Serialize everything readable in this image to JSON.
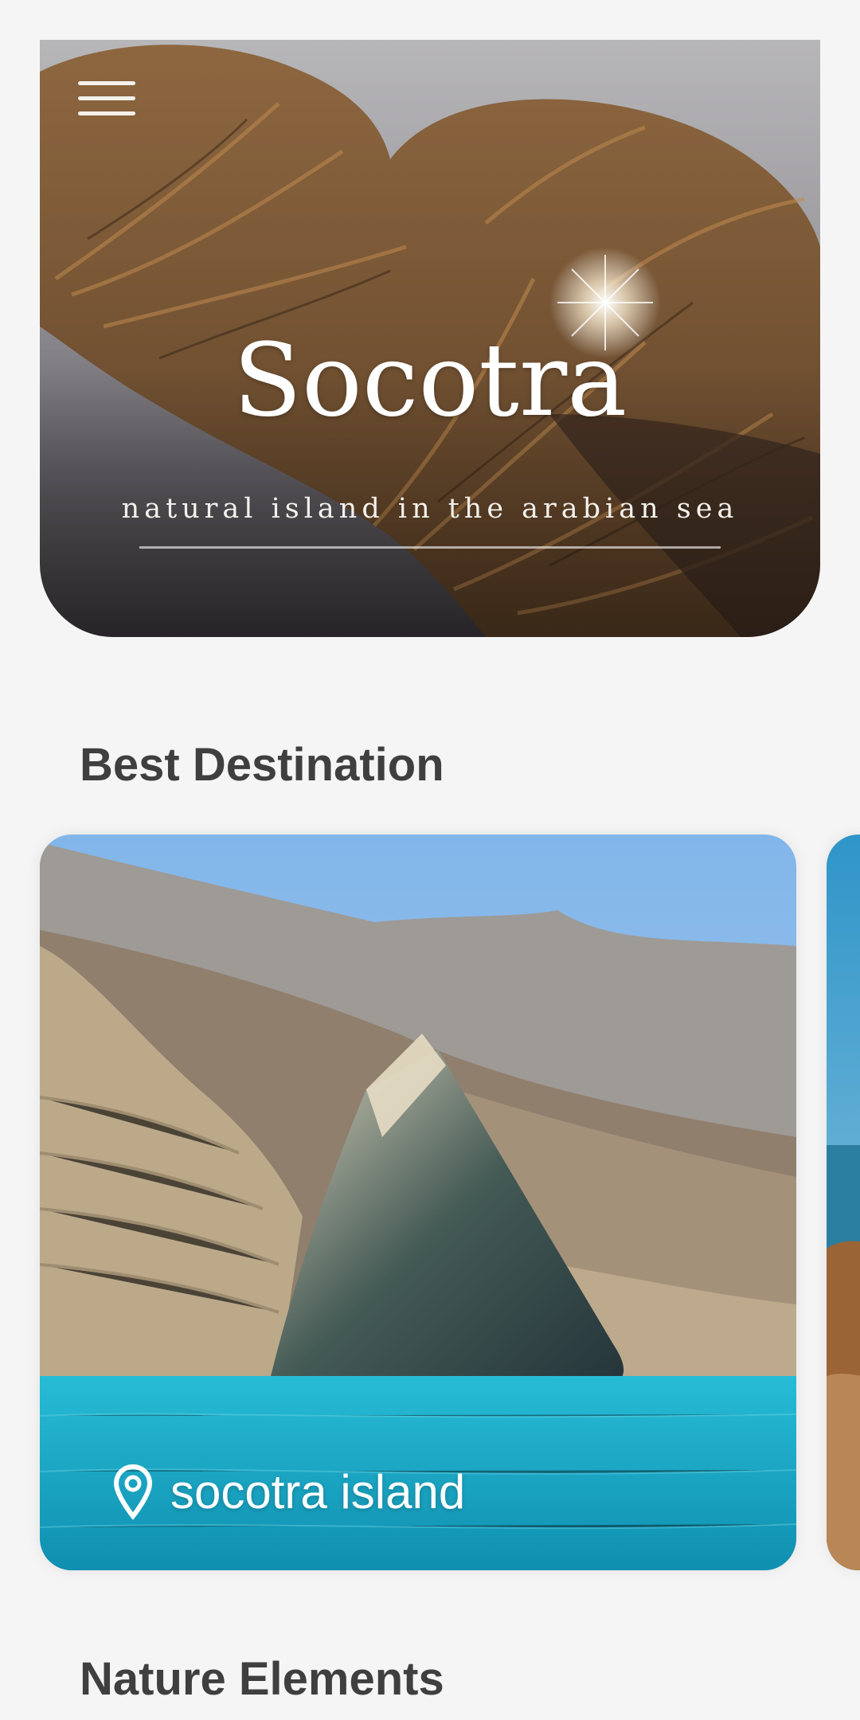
{
  "header": {
    "menu_icon": "hamburger-menu-icon",
    "title": "Socotra",
    "subtitle": "natural island in the arabian sea"
  },
  "sections": {
    "best_destination": {
      "title": "Best Destination",
      "cards": [
        {
          "label": "socotra island",
          "icon": "location-pin-icon"
        }
      ]
    },
    "nature_elements": {
      "title": "Nature Elements"
    }
  },
  "colors": {
    "background": "#f5f5f6",
    "section_title": "#3f3f40",
    "sea": "#1fb2cc",
    "hero_text": "#ffffff"
  }
}
